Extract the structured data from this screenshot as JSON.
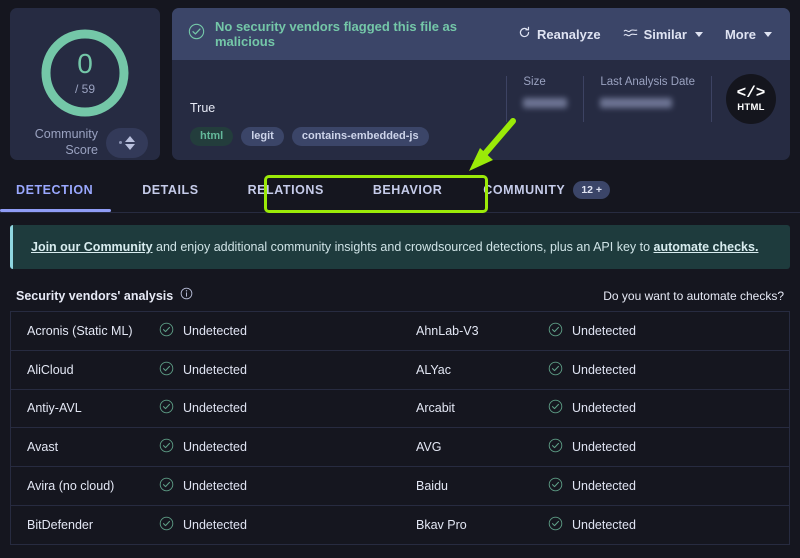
{
  "score_card": {
    "value": "0",
    "denominator": "/ 59",
    "label_line1": "Community",
    "label_line2": "Score",
    "ring_color": "#74c7a8"
  },
  "verdict": {
    "icon": "check-circle-icon",
    "text": "No security vendors flagged this file as malicious",
    "text_color": "#74c7a8",
    "actions": [
      {
        "label": "Reanalyze",
        "icon": "refresh-icon",
        "has_chevron": false
      },
      {
        "label": "Similar",
        "icon": "similar-waves-icon",
        "has_chevron": true
      },
      {
        "label": "More",
        "icon": "",
        "has_chevron": true
      }
    ]
  },
  "file": {
    "hash_redacted": true,
    "name": "True",
    "tags": [
      {
        "label": "html",
        "style": "green"
      },
      {
        "label": "legit",
        "style": "blue"
      },
      {
        "label": "contains-embedded-js",
        "style": "blue"
      }
    ],
    "meta": [
      {
        "label": "Size",
        "value_redacted": true
      },
      {
        "label": "Last Analysis Date",
        "value_redacted": true
      }
    ],
    "type_badge": {
      "symbol": "</>",
      "label": "HTML"
    }
  },
  "tabs": [
    {
      "label": "DETECTION",
      "active": true,
      "badge": ""
    },
    {
      "label": "DETAILS",
      "active": false,
      "badge": ""
    },
    {
      "label": "RELATIONS",
      "active": false,
      "badge": ""
    },
    {
      "label": "BEHAVIOR",
      "active": false,
      "badge": ""
    },
    {
      "label": "COMMUNITY",
      "active": false,
      "badge": "12 +"
    }
  ],
  "annotation": {
    "highlight_color": "#9bea08",
    "arrow_color": "#9bea08",
    "highlights_tabs": [
      "BEHAVIOR",
      "COMMUNITY"
    ]
  },
  "banner": {
    "link_text": "Join our Community",
    "body_text": " and enjoy additional community insights and crowdsourced detections, plus an API key to ",
    "link_text_2": "automate checks.",
    "accent_color": "#8fd6e0"
  },
  "analysis": {
    "title": "Security vendors' analysis",
    "info_icon": "info-icon",
    "automate_question": "Do you want to automate checks?",
    "status_label": "Undetected",
    "status_icon": "check-circle-icon",
    "rows": [
      {
        "left": "Acronis (Static ML)",
        "left_status": "Undetected",
        "right": "AhnLab-V3",
        "right_status": "Undetected"
      },
      {
        "left": "AliCloud",
        "left_status": "Undetected",
        "right": "ALYac",
        "right_status": "Undetected"
      },
      {
        "left": "Antiy-AVL",
        "left_status": "Undetected",
        "right": "Arcabit",
        "right_status": "Undetected"
      },
      {
        "left": "Avast",
        "left_status": "Undetected",
        "right": "AVG",
        "right_status": "Undetected"
      },
      {
        "left": "Avira (no cloud)",
        "left_status": "Undetected",
        "right": "Baidu",
        "right_status": "Undetected"
      },
      {
        "left": "BitDefender",
        "left_status": "Undetected",
        "right": "Bkav Pro",
        "right_status": "Undetected"
      }
    ]
  }
}
